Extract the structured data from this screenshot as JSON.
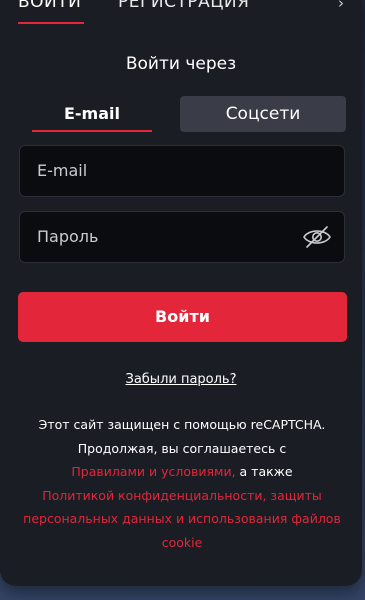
{
  "top_tabs": {
    "login_label": "ВОЙТИ",
    "register_label": "РЕГИСТРАЦИЯ"
  },
  "login_via": "Войти через",
  "method_tabs": {
    "email_label": "E-mail",
    "social_label": "Соцсети"
  },
  "form": {
    "email_placeholder": "E-mail",
    "password_placeholder": "Пароль",
    "submit_label": "Войти"
  },
  "forgot_password": "Забыли пароль?",
  "legal": {
    "line1": "Этот сайт защищен с помощью reCAPTCHA.",
    "line2": "Продолжая, вы соглашаетесь с",
    "terms_link": "Правилами и условиями,",
    "and_also": " а также",
    "privacy_link": "Политикой конфиденциальности, защиты персональных данных и использования файлов cookie"
  },
  "colors": {
    "accent": "#e3263a",
    "modal_bg": "#1b1d24",
    "field_bg": "#0b0c10",
    "tab_inactive_bg": "#3a3c48"
  },
  "icons": {
    "password_toggle": "eye-off-icon",
    "close": "chevron-right-icon"
  }
}
